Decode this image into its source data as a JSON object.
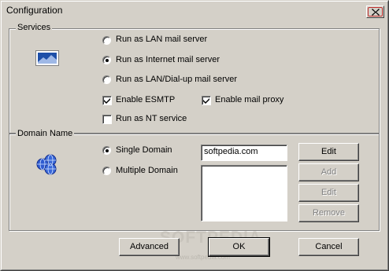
{
  "window": {
    "title": "Configuration"
  },
  "services": {
    "label": "Services",
    "options": [
      {
        "label": "Run as LAN mail server",
        "selected": false
      },
      {
        "label": "Run as Internet mail server",
        "selected": true
      },
      {
        "label": "Run as LAN/Dial-up mail server",
        "selected": false
      }
    ],
    "checks": {
      "esmtp": {
        "label": "Enable ESMTP",
        "checked": true
      },
      "proxy": {
        "label": "Enable mail proxy",
        "checked": true
      },
      "nt_service": {
        "label": "Run as NT service",
        "checked": false
      }
    }
  },
  "domain": {
    "label": "Domain Name",
    "single_label": "Single Domain",
    "multiple_label": "Multiple Domain",
    "single_value": "softpedia.com",
    "multiple_list": [],
    "buttons": {
      "edit": "Edit",
      "add": "Add",
      "edit2": "Edit",
      "remove": "Remove"
    }
  },
  "footer": {
    "advanced": "Advanced",
    "ok": "OK",
    "cancel": "Cancel"
  },
  "watermark": {
    "text": "SOFTPEDIA",
    "url": "www.softpedia.com"
  },
  "colors": {
    "face": "#d4d0c8",
    "shadow": "#808080",
    "highlight": "#ffffff"
  }
}
